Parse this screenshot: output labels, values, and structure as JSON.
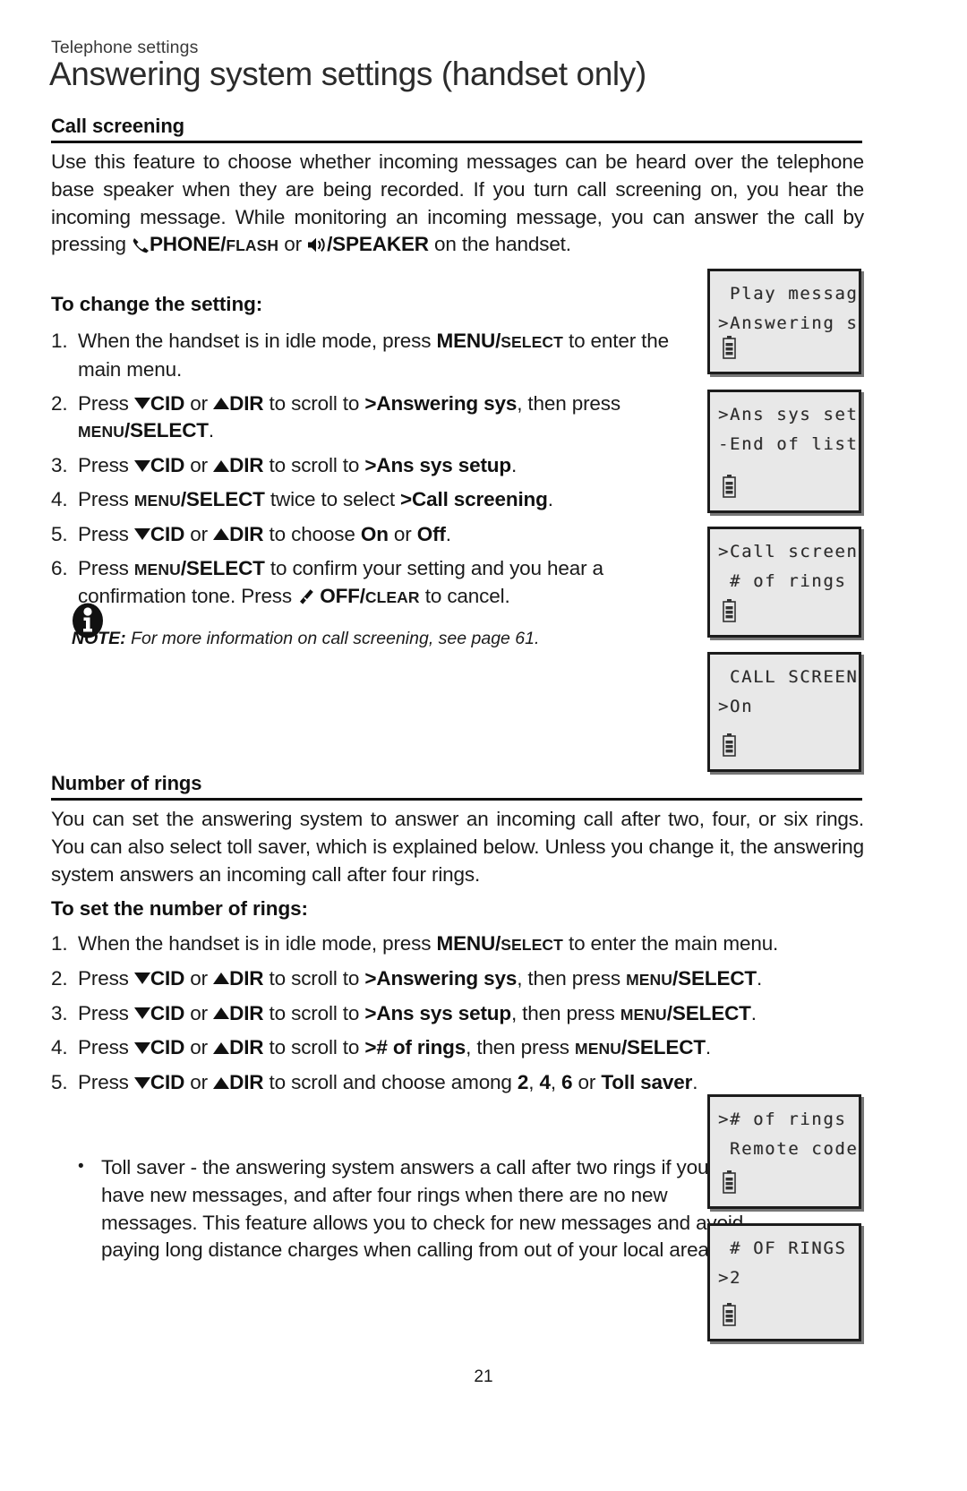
{
  "header": {
    "kicker": "Telephone settings",
    "title": "Answering system settings (handset only)"
  },
  "sections": [
    {
      "heading": "Call screening",
      "intro_part1": "Use this feature to choose whether incoming messages can be heard over the telephone base speaker when they are being recorded. If you turn call screening on, you hear the incoming message. While monitoring an incoming message, you can answer the call by pressing ",
      "intro_phone_label": "PHONE/",
      "intro_phone_sc": "FLASH",
      "intro_or": " or ",
      "intro_speaker_label": "/SPEAKER",
      "intro_part2": " on the handset.",
      "subhead": "To change the setting:",
      "steps": [
        {
          "num": "1.",
          "segments": [
            {
              "t": "text",
              "v": "When the handset is in idle mode, press "
            },
            {
              "t": "bold",
              "v": "MENU/"
            },
            {
              "t": "smallcaps",
              "v": "SELECT"
            },
            {
              "t": "text",
              "v": " to enter the main menu."
            }
          ]
        },
        {
          "num": "2.",
          "segments": [
            {
              "t": "text",
              "v": "Press "
            },
            {
              "t": "tri-down",
              "v": ""
            },
            {
              "t": "bold",
              "v": "CID"
            },
            {
              "t": "text",
              "v": " or "
            },
            {
              "t": "tri-up",
              "v": ""
            },
            {
              "t": "bold",
              "v": "DIR"
            },
            {
              "t": "text",
              "v": " to scroll to "
            },
            {
              "t": "bold",
              "v": ">Answering sys"
            },
            {
              "t": "text",
              "v": ", then press "
            },
            {
              "t": "smallcaps",
              "v": "MENU"
            },
            {
              "t": "bold",
              "v": "/SELECT"
            },
            {
              "t": "text",
              "v": "."
            }
          ]
        },
        {
          "num": "3.",
          "segments": [
            {
              "t": "text",
              "v": "Press "
            },
            {
              "t": "tri-down",
              "v": ""
            },
            {
              "t": "bold",
              "v": "CID"
            },
            {
              "t": "text",
              "v": " or "
            },
            {
              "t": "tri-up",
              "v": ""
            },
            {
              "t": "bold",
              "v": "DIR"
            },
            {
              "t": "text",
              "v": " to scroll to "
            },
            {
              "t": "bold",
              "v": ">Ans sys setup"
            },
            {
              "t": "text",
              "v": "."
            }
          ]
        },
        {
          "num": "4.",
          "segments": [
            {
              "t": "text",
              "v": "Press "
            },
            {
              "t": "smallcaps",
              "v": "MENU"
            },
            {
              "t": "bold",
              "v": "/SELECT"
            },
            {
              "t": "text",
              "v": " twice to select "
            },
            {
              "t": "bold",
              "v": ">Call screening"
            },
            {
              "t": "text",
              "v": "."
            }
          ]
        },
        {
          "num": "5.",
          "segments": [
            {
              "t": "text",
              "v": "Press "
            },
            {
              "t": "tri-down",
              "v": ""
            },
            {
              "t": "bold",
              "v": "CID"
            },
            {
              "t": "text",
              "v": " or "
            },
            {
              "t": "tri-up",
              "v": ""
            },
            {
              "t": "bold",
              "v": "DIR"
            },
            {
              "t": "text",
              "v": " to choose "
            },
            {
              "t": "bold",
              "v": "On"
            },
            {
              "t": "text",
              "v": " or "
            },
            {
              "t": "bold",
              "v": "Off"
            },
            {
              "t": "text",
              "v": "."
            }
          ]
        },
        {
          "num": "6.",
          "segments": [
            {
              "t": "text",
              "v": "Press "
            },
            {
              "t": "smallcaps",
              "v": "MENU"
            },
            {
              "t": "bold",
              "v": "/SELECT"
            },
            {
              "t": "text",
              "v": " to confirm your setting and you hear a confirmation tone. Press "
            },
            {
              "t": "off-icon",
              "v": ""
            },
            {
              "t": "bold",
              "v": " OFF/"
            },
            {
              "t": "smallcaps",
              "v": "CLEAR"
            },
            {
              "t": "text",
              "v": " to cancel."
            }
          ]
        }
      ],
      "note": {
        "label": "NOTE:",
        "text": " For more information on call screening, see page 61."
      }
    },
    {
      "heading": "Number of rings",
      "intro": "You can set the answering system to answer an incoming call after two, four, or six rings. You can also select toll saver, which is explained below. Unless you change it, the answering system answers an incoming call after four rings.",
      "subhead": "To set the number of rings:",
      "steps": [
        {
          "num": "1.",
          "segments": [
            {
              "t": "text",
              "v": "When the handset is in idle mode, press "
            },
            {
              "t": "bold",
              "v": "MENU/"
            },
            {
              "t": "smallcaps",
              "v": "SELECT"
            },
            {
              "t": "text",
              "v": " to enter the main menu."
            }
          ]
        },
        {
          "num": "2.",
          "segments": [
            {
              "t": "text",
              "v": "Press "
            },
            {
              "t": "tri-down",
              "v": ""
            },
            {
              "t": "bold",
              "v": "CID"
            },
            {
              "t": "text",
              "v": " or "
            },
            {
              "t": "tri-up",
              "v": ""
            },
            {
              "t": "bold",
              "v": "DIR"
            },
            {
              "t": "text",
              "v": " to scroll to "
            },
            {
              "t": "bold",
              "v": ">Answering sys"
            },
            {
              "t": "text",
              "v": ", then press "
            },
            {
              "t": "smallcaps",
              "v": "MENU"
            },
            {
              "t": "bold",
              "v": "/SELECT"
            },
            {
              "t": "text",
              "v": "."
            }
          ]
        },
        {
          "num": "3.",
          "segments": [
            {
              "t": "text",
              "v": "Press "
            },
            {
              "t": "tri-down",
              "v": ""
            },
            {
              "t": "bold",
              "v": "CID"
            },
            {
              "t": "text",
              "v": " or "
            },
            {
              "t": "tri-up",
              "v": ""
            },
            {
              "t": "bold",
              "v": "DIR"
            },
            {
              "t": "text",
              "v": " to scroll to "
            },
            {
              "t": "bold",
              "v": ">Ans sys setup"
            },
            {
              "t": "text",
              "v": ", then press "
            },
            {
              "t": "smallcaps",
              "v": "MENU"
            },
            {
              "t": "bold",
              "v": "/SELECT"
            },
            {
              "t": "text",
              "v": "."
            }
          ]
        },
        {
          "num": "4.",
          "segments": [
            {
              "t": "text",
              "v": "Press "
            },
            {
              "t": "tri-down",
              "v": ""
            },
            {
              "t": "bold",
              "v": "CID"
            },
            {
              "t": "text",
              "v": " or "
            },
            {
              "t": "tri-up",
              "v": ""
            },
            {
              "t": "bold",
              "v": "DIR"
            },
            {
              "t": "text",
              "v": " to scroll to "
            },
            {
              "t": "bold",
              "v": "># of rings"
            },
            {
              "t": "text",
              "v": ", then press "
            },
            {
              "t": "smallcaps",
              "v": "MENU"
            },
            {
              "t": "bold",
              "v": "/SELECT"
            },
            {
              "t": "text",
              "v": "."
            }
          ]
        },
        {
          "num": "5.",
          "segments": [
            {
              "t": "text",
              "v": "Press "
            },
            {
              "t": "tri-down",
              "v": ""
            },
            {
              "t": "bold",
              "v": "CID"
            },
            {
              "t": "text",
              "v": " or "
            },
            {
              "t": "tri-up",
              "v": ""
            },
            {
              "t": "bold",
              "v": "DIR"
            },
            {
              "t": "text",
              "v": " to scroll and choose among "
            },
            {
              "t": "bold",
              "v": "2"
            },
            {
              "t": "text",
              "v": ", "
            },
            {
              "t": "bold",
              "v": "4"
            },
            {
              "t": "text",
              "v": ", "
            },
            {
              "t": "bold",
              "v": "6"
            },
            {
              "t": "text",
              "v": " or "
            },
            {
              "t": "bold",
              "v": "Toll saver"
            },
            {
              "t": "text",
              "v": "."
            }
          ]
        }
      ],
      "bullet": {
        "marker": "•",
        "text": "Toll saver - the answering system answers a call after two rings if you have new messages, and after four rings when there are no new messages. This feature allows you to check for new messages and avoid paying long distance charges when calling from out of your local area."
      }
    }
  ],
  "lcd_screens": [
    {
      "id": "play-messages",
      "line1": " Play messages",
      "line2": ">Answering sys"
    },
    {
      "id": "ans-sys-setup",
      "line1": ">Ans sys setup",
      "line2": "-End of list-"
    },
    {
      "id": "call-screening-menu",
      "line1": ">Call screening",
      "line2": " # of rings"
    },
    {
      "id": "call-screening-on",
      "line1": " CALL SCREENING",
      "line2": ">On"
    },
    {
      "id": "num-of-rings-menu",
      "line1": "># of rings",
      "line2": " Remote code"
    },
    {
      "id": "num-of-rings-value",
      "line1": " # OF RINGS",
      "line2": ">2"
    }
  ],
  "footer": {
    "page_number": "21"
  },
  "colors": {
    "text": "#1a1a1a",
    "rule": "#111111",
    "lcd_bg": "#e8e8e8",
    "lcd_border": "#1c1c1c"
  }
}
